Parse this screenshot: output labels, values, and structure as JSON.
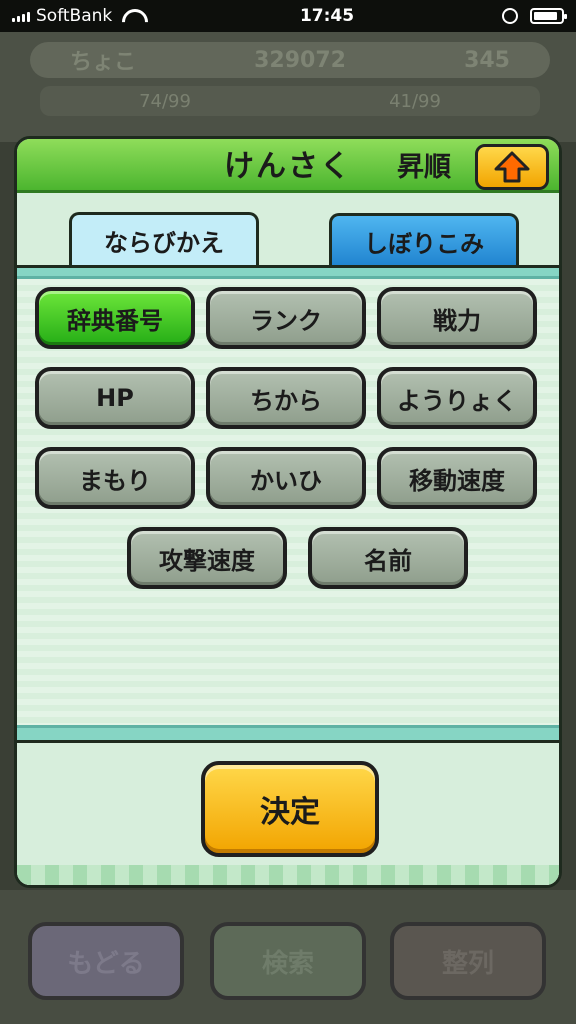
{
  "status_bar": {
    "carrier": "SoftBank",
    "time": "17:45"
  },
  "background": {
    "player_name": "ちょこ",
    "currency1": "329072",
    "currency2": "345",
    "stat1": "74/99",
    "stat2": "41/99",
    "buttons": [
      "もどる",
      "検索",
      "整列"
    ]
  },
  "dialog": {
    "title": "けんさく",
    "sort_order_label": "昇順",
    "tabs": [
      {
        "label": "ならびかえ",
        "active": true
      },
      {
        "label": "しぼりこみ",
        "active": false
      }
    ],
    "options": [
      {
        "label": "辞典番号",
        "selected": true
      },
      {
        "label": "ランク",
        "selected": false
      },
      {
        "label": "戦力",
        "selected": false
      },
      {
        "label": "HP",
        "selected": false
      },
      {
        "label": "ちから",
        "selected": false
      },
      {
        "label": "ようりょく",
        "selected": false
      },
      {
        "label": "まもり",
        "selected": false
      },
      {
        "label": "かいひ",
        "selected": false
      },
      {
        "label": "移動速度",
        "selected": false
      },
      {
        "label": "攻撃速度",
        "selected": false
      },
      {
        "label": "名前",
        "selected": false
      }
    ],
    "confirm_label": "決定"
  },
  "icons": {
    "sort_button": "arrow-up-icon"
  },
  "colors": {
    "header_green": "#4cb52f",
    "selected_green": "#25ad16",
    "confirm_yellow": "#f2a400",
    "tab_blue": "#1f83cf"
  }
}
